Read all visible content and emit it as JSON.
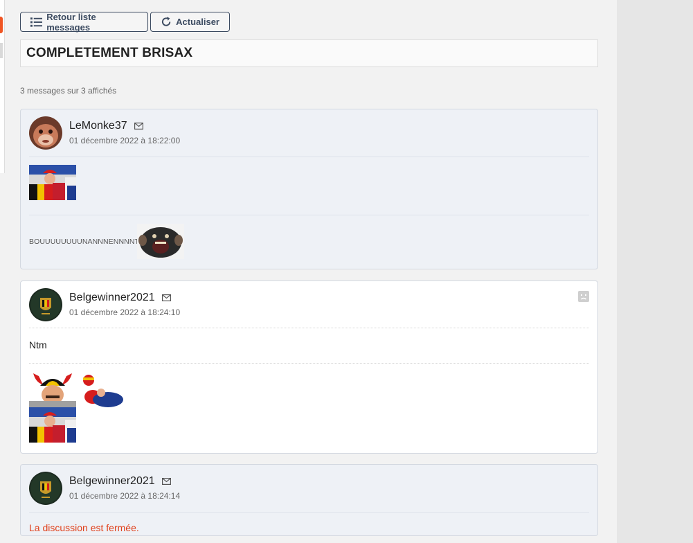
{
  "toolbar": {
    "back_label": "Retour liste messages",
    "refresh_label": "Actualiser"
  },
  "topic": {
    "title": "COMPLETEMENT BRISAX",
    "count_text": "3 messages sur 3 affichés"
  },
  "messages": [
    {
      "author": "LeMonke37",
      "date": "01 décembre 2022 à 18:22:00",
      "stickers": [
        "sticker-cheering-fan",
        "sticker-monkey-scream"
      ],
      "signature": "BOUUUUUUUUNANNNENNNNT"
    },
    {
      "author": "Belgewinner2021",
      "date": "01 décembre 2022 à 18:24:10",
      "text": "Ntm",
      "stickers": [
        "sticker-belgian-horns",
        "sticker-football-fan",
        "sticker-cheering-fan"
      ]
    },
    {
      "author": "Belgewinner2021",
      "date": "01 décembre 2022 à 18:24:14",
      "closed_text": "La discussion est fermée."
    }
  ],
  "colors": {
    "accent_orange": "#f05523",
    "closed_red": "#e0401b",
    "button_border": "#3b4a60"
  }
}
